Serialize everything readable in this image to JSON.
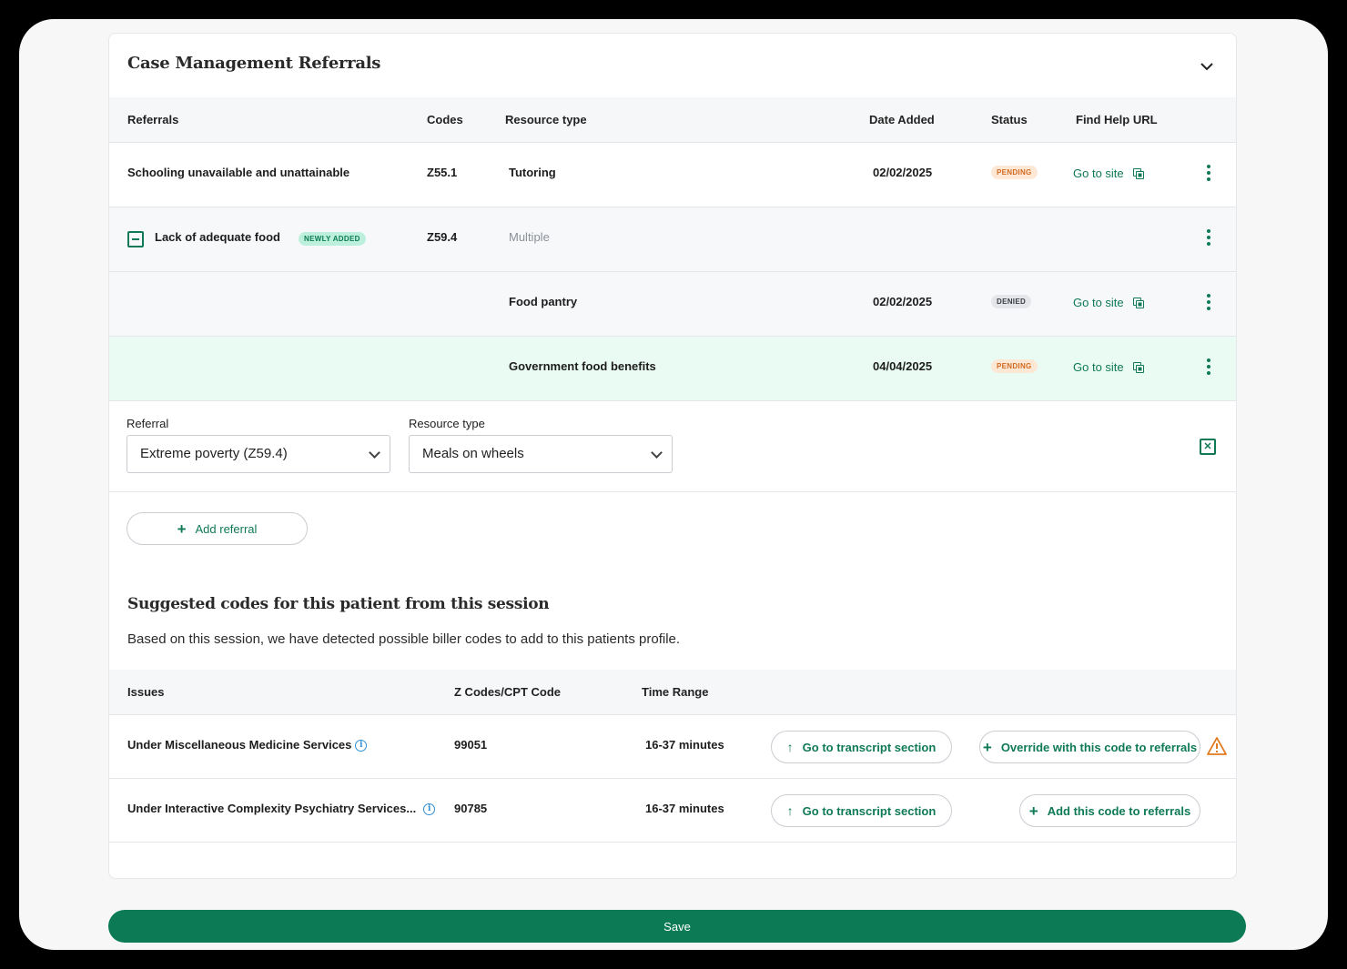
{
  "card": {
    "title": "Case Management Referrals"
  },
  "referrals_table": {
    "headers": {
      "referrals": "Referrals",
      "codes": "Codes",
      "resource_type": "Resource type",
      "date_added": "Date Added",
      "status": "Status",
      "find_help_url": "Find Help URL"
    },
    "rows": [
      {
        "referral": "Schooling unavailable and unattainable",
        "code": "Z55.1",
        "resource_type": "Tutoring",
        "date_added": "02/02/2025",
        "status": "PENDING",
        "link": "Go to site"
      },
      {
        "referral": "Lack of adequate food",
        "badge": "NEWLY ADDED",
        "code": "Z59.4",
        "resource_type": "Multiple"
      },
      {
        "resource_type": "Food pantry",
        "date_added": "02/02/2025",
        "status": "DENIED",
        "link": "Go to site"
      },
      {
        "resource_type": "Government food benefits",
        "date_added": "04/04/2025",
        "status": "PENDING",
        "link": "Go to site"
      }
    ]
  },
  "form": {
    "referral_label": "Referral",
    "referral_value": "Extreme poverty (Z59.4)",
    "resource_label": "Resource type",
    "resource_value": "Meals on wheels"
  },
  "add_referral": "Add referral",
  "suggested": {
    "title": "Suggested codes for this patient from this session",
    "description": "Based on this session, we have detected possible biller codes to add to this patients profile.",
    "headers": {
      "issues": "Issues",
      "codes": "Z Codes/CPT Code",
      "time_range": "Time Range"
    },
    "rows": [
      {
        "issue": "Under Miscellaneous Medicine Services",
        "code": "99051",
        "time_range": "16-37 minutes",
        "transcript": "Go to transcript section",
        "action": "Override with this code to referrals",
        "warning": true
      },
      {
        "issue": "Under Interactive Complexity Psychiatry Services...",
        "code": "90785",
        "time_range": "16-37 minutes",
        "transcript": "Go to transcript section",
        "action": "Add this code to referrals"
      }
    ]
  },
  "save_label": "Save",
  "colors": {
    "accent": "#0b7a55",
    "pending_bg": "#fde8d6",
    "pending_fg": "#d2691e",
    "selected_row": "#e9fbf3",
    "warning": "#e07a1f"
  }
}
